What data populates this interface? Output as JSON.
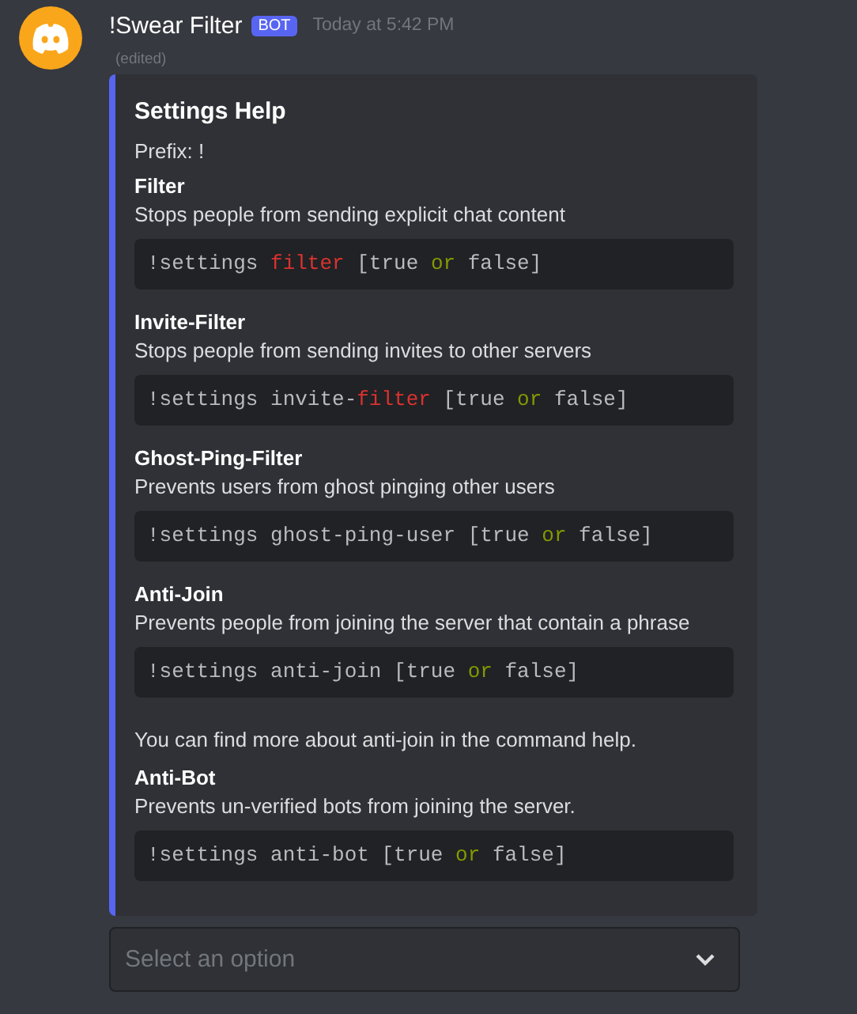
{
  "message": {
    "author": "!Swear Filter",
    "badge": "BOT",
    "timestamp": "Today at 5:42 PM",
    "edited": "(edited)"
  },
  "embed": {
    "title": "Settings Help",
    "prefix": "Prefix: !",
    "fields": [
      {
        "name": "Filter",
        "description": "Stops people from sending explicit chat content",
        "code": [
          {
            "text": "!settings ",
            "kind": "plain"
          },
          {
            "text": "filter",
            "kind": "keyword"
          },
          {
            "text": " [true ",
            "kind": "plain"
          },
          {
            "text": "or",
            "kind": "operator"
          },
          {
            "text": " false]",
            "kind": "plain"
          }
        ]
      },
      {
        "name": "Invite-Filter",
        "description": "Stops people from sending invites to other servers",
        "code": [
          {
            "text": "!settings invite-",
            "kind": "plain"
          },
          {
            "text": "filter",
            "kind": "keyword"
          },
          {
            "text": " [true ",
            "kind": "plain"
          },
          {
            "text": "or",
            "kind": "operator"
          },
          {
            "text": " false]",
            "kind": "plain"
          }
        ]
      },
      {
        "name": "Ghost-Ping-Filter",
        "description": "Prevents users from ghost pinging other users",
        "code": [
          {
            "text": "!settings ghost-ping-user [true ",
            "kind": "plain"
          },
          {
            "text": "or",
            "kind": "operator"
          },
          {
            "text": " false]",
            "kind": "plain"
          }
        ]
      },
      {
        "name": "Anti-Join",
        "description": "Prevents people from joining the server that contain a phrase",
        "code": [
          {
            "text": "!settings anti-join [true ",
            "kind": "plain"
          },
          {
            "text": "or",
            "kind": "operator"
          },
          {
            "text": " false]",
            "kind": "plain"
          }
        ],
        "note": "You can find more about anti-join in the command help."
      },
      {
        "name": "Anti-Bot",
        "description": "Prevents un-verified bots from joining the server.",
        "code": [
          {
            "text": "!settings anti-bot [true ",
            "kind": "plain"
          },
          {
            "text": "or",
            "kind": "operator"
          },
          {
            "text": " false]",
            "kind": "plain"
          }
        ]
      }
    ]
  },
  "select": {
    "placeholder": "Select an option"
  }
}
